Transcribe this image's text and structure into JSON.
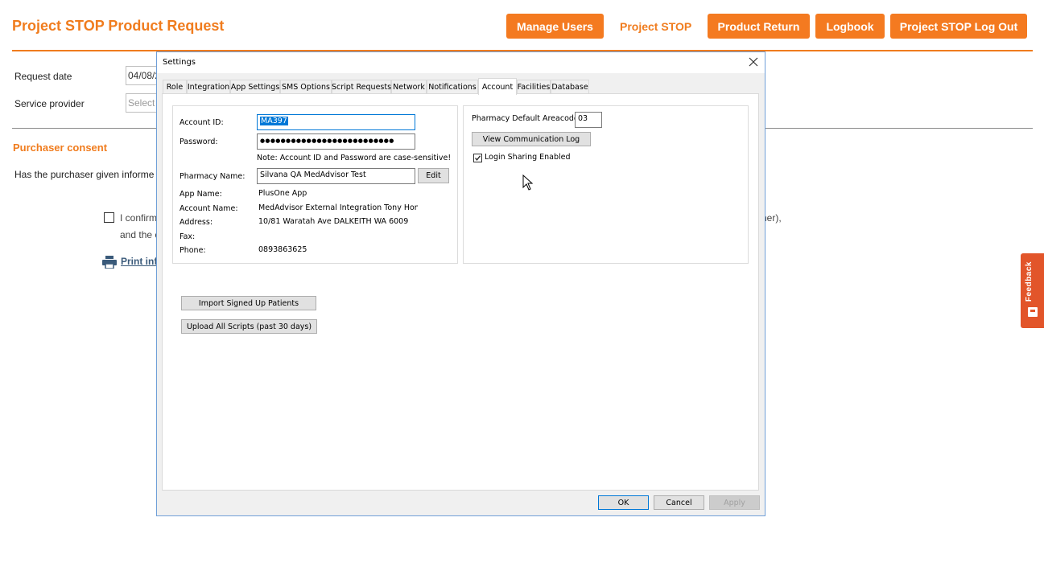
{
  "header": {
    "title": "Project STOP Product Request",
    "nav": {
      "manage_users": "Manage Users",
      "project_stop": "Project STOP",
      "product_return": "Product Return",
      "logbook": "Logbook",
      "logout": "Project STOP Log Out"
    }
  },
  "form": {
    "request_date_label": "Request date",
    "request_date_value": "04/08/2",
    "service_provider_label": "Service provider",
    "service_provider_placeholder": "Select"
  },
  "consent": {
    "section_title": "Purchaser consent",
    "question": "Has the purchaser given informe",
    "confirm_text_line1": "I confirm",
    "confirm_text_line2": "and the c",
    "confirm_text_tail": "her),",
    "print_link": "Print inf"
  },
  "feedback": {
    "label": "Feedback"
  },
  "dialog": {
    "title": "Settings",
    "tabs": [
      "Role",
      "Integration",
      "App Settings",
      "SMS Options",
      "Script Requests",
      "Network",
      "Notifications",
      "Account",
      "Facilities",
      "Database"
    ],
    "active_tab": "Account",
    "account": {
      "account_id_label": "Account ID:",
      "account_id_value": "MA397",
      "password_label": "Password:",
      "password_value": "●●●●●●●●●●●●●●●●●●●●●●●●●●",
      "case_note": "Note: Account ID and Password are case-sensitive!",
      "pharmacy_name_label": "Pharmacy Name:",
      "pharmacy_name_value": "Silvana QA MedAdvisor Test",
      "edit_button": "Edit",
      "app_name_label": "App Name:",
      "app_name_value": "PlusOne App",
      "account_name_label": "Account Name:",
      "account_name_value": "MedAdvisor External Integration Tony Hon(long r",
      "address_label": "Address:",
      "address_value": "10/81 Waratah Ave DALKEITH WA 6009",
      "fax_label": "Fax:",
      "fax_value": "",
      "phone_label": "Phone:",
      "phone_value": "0893863625"
    },
    "right": {
      "areacode_label": "Pharmacy Default Areacode:",
      "areacode_value": "03",
      "view_log_button": "View Communication Log",
      "login_sharing_label": "Login Sharing Enabled",
      "login_sharing_checked": true
    },
    "actions": {
      "import_button": "Import Signed Up Patients",
      "upload_button": "Upload All Scripts (past 30 days)"
    },
    "footer": {
      "ok": "OK",
      "cancel": "Cancel",
      "apply": "Apply"
    }
  }
}
